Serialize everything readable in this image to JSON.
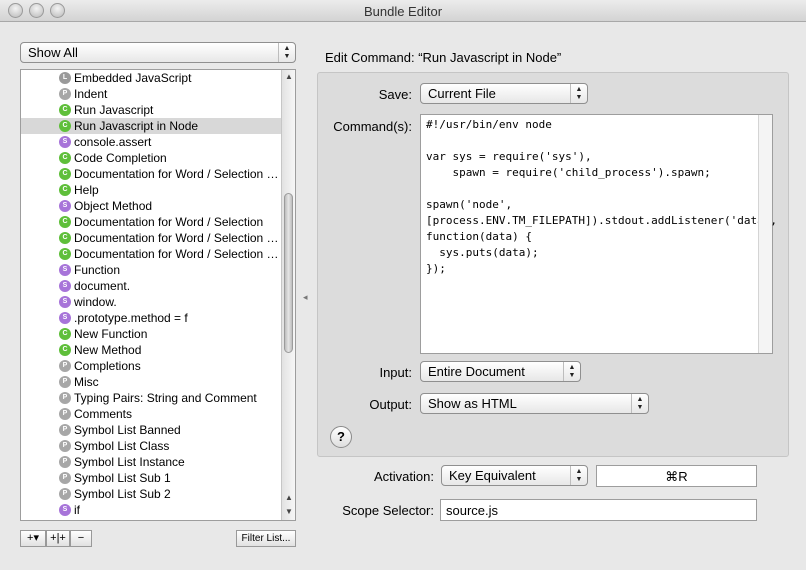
{
  "window": {
    "title": "Bundle Editor"
  },
  "filter": {
    "selected": "Show All"
  },
  "list": {
    "items": [
      {
        "label": "Embedded JavaScript",
        "badge": "L",
        "kind": "language",
        "selected": false
      },
      {
        "label": "Indent",
        "badge": "P",
        "kind": "preference",
        "selected": false
      },
      {
        "label": "Run Javascript",
        "badge": "C",
        "kind": "command",
        "selected": false
      },
      {
        "label": "Run Javascript in Node",
        "badge": "C",
        "kind": "command",
        "selected": true
      },
      {
        "label": "console.assert",
        "badge": "S",
        "kind": "snippet",
        "selected": false
      },
      {
        "label": "Code Completion",
        "badge": "C",
        "kind": "command",
        "selected": false
      },
      {
        "label": "Documentation for Word / Selection (t…",
        "badge": "C",
        "kind": "command",
        "selected": false
      },
      {
        "label": "Help",
        "badge": "C",
        "kind": "command",
        "selected": false
      },
      {
        "label": "Object Method",
        "badge": "S",
        "kind": "snippet",
        "selected": false
      },
      {
        "label": "Documentation for Word / Selection",
        "badge": "C",
        "kind": "command",
        "selected": false
      },
      {
        "label": "Documentation for Word / Selection G…",
        "badge": "C",
        "kind": "command",
        "selected": false
      },
      {
        "label": "Documentation for Word / Selection G…",
        "badge": "C",
        "kind": "command",
        "selected": false
      },
      {
        "label": "Function",
        "badge": "S",
        "kind": "snippet",
        "selected": false
      },
      {
        "label": "document.",
        "badge": "S",
        "kind": "snippet",
        "selected": false
      },
      {
        "label": "window.",
        "badge": "S",
        "kind": "snippet",
        "selected": false
      },
      {
        "label": ".prototype.method = f",
        "badge": "S",
        "kind": "snippet",
        "selected": false
      },
      {
        "label": "New Function",
        "badge": "C",
        "kind": "command",
        "selected": false
      },
      {
        "label": "New Method",
        "badge": "C",
        "kind": "command",
        "selected": false
      },
      {
        "label": "Completions",
        "badge": "P",
        "kind": "preference",
        "selected": false
      },
      {
        "label": "Misc",
        "badge": "P",
        "kind": "preference",
        "selected": false
      },
      {
        "label": "Typing Pairs: String and Comment",
        "badge": "P",
        "kind": "preference",
        "selected": false
      },
      {
        "label": "Comments",
        "badge": "P",
        "kind": "preference",
        "selected": false
      },
      {
        "label": "Symbol List Banned",
        "badge": "P",
        "kind": "preference",
        "selected": false
      },
      {
        "label": "Symbol List Class",
        "badge": "P",
        "kind": "preference",
        "selected": false
      },
      {
        "label": "Symbol List Instance",
        "badge": "P",
        "kind": "preference",
        "selected": false
      },
      {
        "label": "Symbol List Sub 1",
        "badge": "P",
        "kind": "preference",
        "selected": false
      },
      {
        "label": "Symbol List Sub 2",
        "badge": "P",
        "kind": "preference",
        "selected": false
      },
      {
        "label": "if",
        "badge": "S",
        "kind": "snippet",
        "selected": false
      }
    ],
    "badge_colors": {
      "language": "#9a9a9a",
      "preference": "#a7a7a7",
      "command": "#5fbf3a",
      "snippet": "#a774d9"
    },
    "scroll_fraction": 0.42
  },
  "toolbar": {
    "add_label": "+▾",
    "add_group_label": "+|+",
    "remove_label": "−",
    "filter_label": "Filter List..."
  },
  "editor": {
    "heading": "Edit Command: “Run Javascript in Node”",
    "save_label": "Save:",
    "save_value": "Current File",
    "command_label": "Command(s):",
    "command_text": "#!/usr/bin/env node\n\nvar sys = require('sys'),\n    spawn = require('child_process').spawn;\n\nspawn('node',\n[process.ENV.TM_FILEPATH]).stdout.addListener('data',\nfunction(data) {\n  sys.puts(data);\n});",
    "input_label": "Input:",
    "input_value": "Entire Document",
    "output_label": "Output:",
    "output_value": "Show as HTML",
    "help_label": "?"
  },
  "activation": {
    "label": "Activation:",
    "type_value": "Key Equivalent",
    "key_value": "⌘R"
  },
  "scope": {
    "label": "Scope Selector:",
    "value": "source.js"
  },
  "icons": {
    "arrows": "▲▼",
    "close": "close-icon",
    "minimize": "minimize-icon",
    "zoom": "zoom-icon"
  }
}
